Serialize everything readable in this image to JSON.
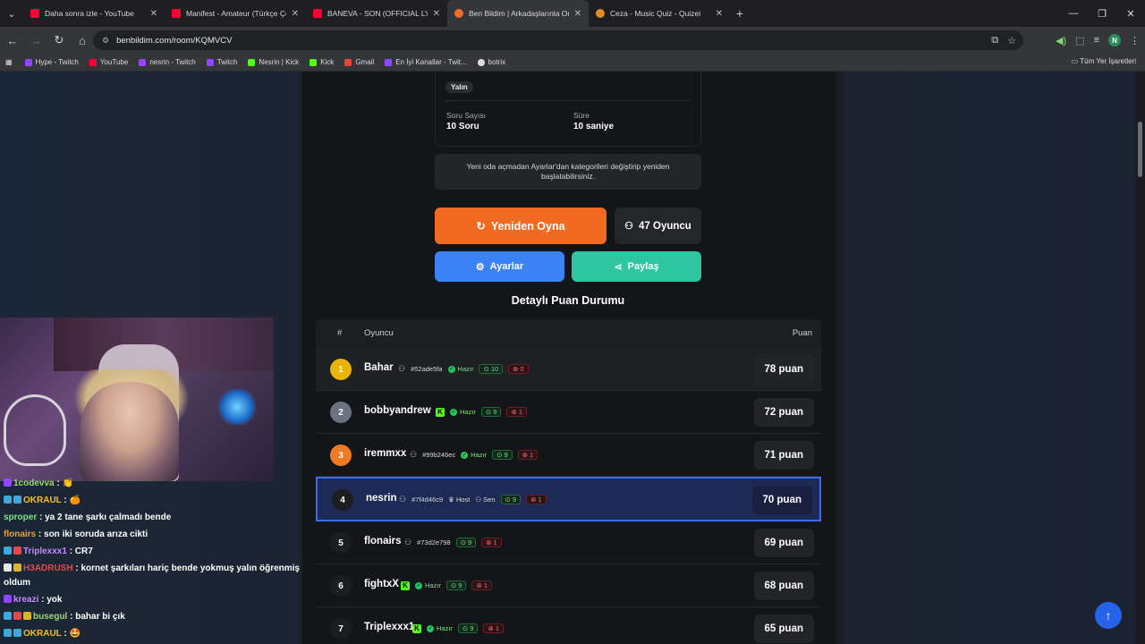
{
  "browser": {
    "tabs": [
      {
        "title": "Daha sonra izle - YouTube",
        "icon": "youtube-icon"
      },
      {
        "title": "Manifest - Amateur (Türkçe Çev",
        "icon": "youtube-icon"
      },
      {
        "title": "BANEVA - SON (OFFICIAL LYRI",
        "icon": "youtube-icon"
      },
      {
        "title": "Ben Bildim | Arkadaşlarınla Onli",
        "icon": "benbildim-icon"
      },
      {
        "title": "Ceza - Music Quiz - Quizei",
        "icon": "quizei-icon"
      }
    ],
    "active_tab": 3,
    "url": "benbildim.com/room/KQMVCV",
    "profile_initial": "N",
    "bookmarks": [
      "Hype - Twitch",
      "YouTube",
      "nesrin - Twitch",
      "Twitch",
      "Nesrin | Kick",
      "Kick",
      "Gmail",
      "En İyi Kanallar - Twit...",
      "botrix"
    ],
    "bookmarks_folder": "Tüm Yer İşaretleri"
  },
  "room": {
    "difficulty_chip": "Yalın",
    "question_count_label": "Soru Sayısı",
    "question_count": "10 Soru",
    "duration_label": "Süre",
    "duration": "10 saniye",
    "notice": "Yeni oda açmadan Ayarlar'dan kategorileri değiştirip yeniden başlatabilirsiniz.",
    "replay_label": "Yeniden Oyna",
    "players_label": "47 Oyuncu",
    "settings_label": "Ayarlar",
    "share_label": "Paylaş",
    "scoreboard_title": "Detaylı Puan Durumu"
  },
  "table": {
    "headers": {
      "rank": "#",
      "player": "Oyuncu",
      "score": "Puan"
    },
    "rows": [
      {
        "rank": "1",
        "name": "Bahar",
        "platform": "user",
        "id": "#52ade5fa",
        "status": "Hazır",
        "correct": "10",
        "wrong": "0",
        "score": "78 puan"
      },
      {
        "rank": "2",
        "name": "bobbyandrew",
        "platform": "kick",
        "id": "",
        "status": "Hazır",
        "correct": "9",
        "wrong": "1",
        "score": "72 puan"
      },
      {
        "rank": "3",
        "name": "iremmxx",
        "platform": "user",
        "id": "#99b246ec",
        "status": "Hazır",
        "correct": "9",
        "wrong": "1",
        "score": "71 puan"
      },
      {
        "rank": "4",
        "name": "nesrin",
        "platform": "user",
        "id": "#7f4d46c9",
        "host": "Host",
        "you": "Sen",
        "correct": "9",
        "wrong": "1",
        "score": "70 puan"
      },
      {
        "rank": "5",
        "name": "flonairs",
        "platform": "user",
        "id": "#73d2e798",
        "correct": "9",
        "wrong": "1",
        "score": "69 puan"
      },
      {
        "rank": "6",
        "name": "fightxX",
        "platform": "kick",
        "id": "",
        "status": "Hazır",
        "correct": "9",
        "wrong": "1",
        "score": "68 puan"
      },
      {
        "rank": "7",
        "name": "Triplexxx1",
        "platform": "kick",
        "id": "",
        "status": "Hazır",
        "correct": "9",
        "wrong": "1",
        "score": "65 puan"
      }
    ]
  },
  "chat": [
    {
      "user": "1codevva",
      "color": "#9dd86a",
      "msg": ": 👏"
    },
    {
      "user": "OKRAUL",
      "color": "#f0c020",
      "msg": ": 🍊"
    },
    {
      "user": "sproper",
      "color": "#7ee08a",
      "msg": ": ya 2 tane şarkı çalmadı bende"
    },
    {
      "user": "flonairs",
      "color": "#f0a030",
      "msg": ": son iki soruda arıza cikti"
    },
    {
      "user": "Triplexxx1",
      "color": "#c28bff",
      "msg": ": CR7"
    },
    {
      "user": "H3ADRUSH",
      "color": "#e04a4a",
      "msg": ": kornet şarkıları hariç bende yokmuş yalın öğrenmiş"
    },
    {
      "user": "",
      "color": "#ffffff",
      "msg": "oldum"
    },
    {
      "user": "kreazi",
      "color": "#c28bff",
      "msg": ": yok"
    },
    {
      "user": "busegul",
      "color": "#9dd86a",
      "msg": ": bahar bi çık"
    },
    {
      "user": "OKRAUL",
      "color": "#f0c020",
      "msg": ": 🤩"
    }
  ]
}
